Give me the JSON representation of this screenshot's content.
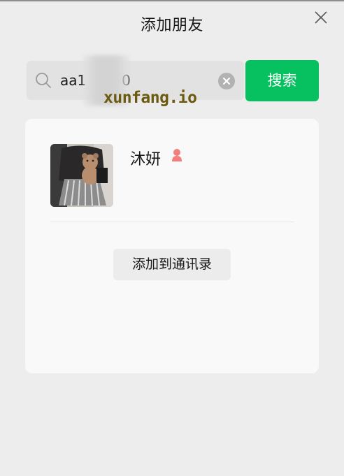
{
  "window": {
    "title": "添加朋友"
  },
  "search": {
    "value": "aa1        0",
    "button_label": "搜索"
  },
  "watermark": {
    "text": "xunfang.io"
  },
  "result": {
    "name": "沐妍",
    "gender_icon": "female-icon",
    "gender_color": "#f37e7e",
    "add_button_label": "添加到通讯录"
  },
  "colors": {
    "accent": "#07c160",
    "background": "#ededed",
    "card": "#f9f9f9"
  }
}
